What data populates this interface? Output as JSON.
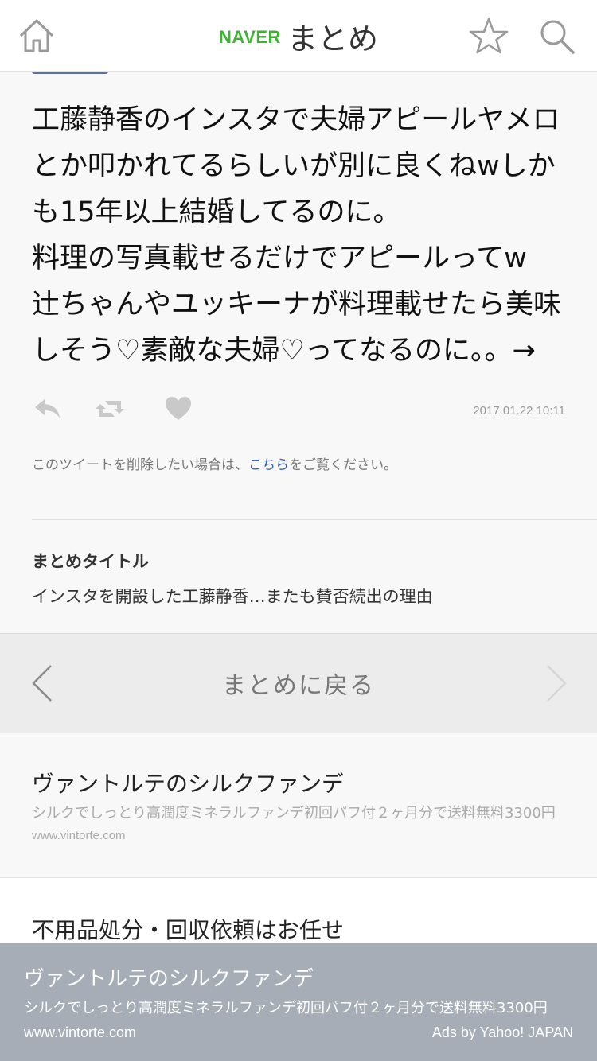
{
  "header": {
    "brand_naver": "NAVER",
    "brand_matome": "まとめ",
    "home_icon": "home-icon",
    "favorite_icon": "star-icon",
    "search_icon": "search-icon",
    "brand_color": "#3db233"
  },
  "tweet": {
    "lines": [
      "工藤静香のインスタで夫婦アピールヤメロ",
      "とか叩かれてるらしいが別に良くねwしか",
      "も15年以上結婚してるのに。",
      "料理の写真載せるだけでアピールってw",
      "辻ちゃんやユッキーナが料理載せたら美味",
      "しそう♡素敵な夫婦♡ってなるのに。。→"
    ],
    "timestamp": "2017.01.22 10:11",
    "actions": [
      "reply-icon",
      "retweet-icon",
      "like-icon"
    ],
    "delete_note_prefix": "このツイートを削除したい場合は、",
    "delete_note_link": "こちら",
    "delete_note_suffix": "をご覧ください。"
  },
  "matome": {
    "title_label": "まとめタイトル",
    "title_value": "インスタを開設した工藤静香…またも賛否続出の理由"
  },
  "back_bar": {
    "label": "まとめに戻る"
  },
  "ads": [
    {
      "title": "ヴァントルテのシルクファンデ",
      "description": "シルクでしっとり高潤度ミネラルファンデ初回パフ付２ヶ月分で送料無料3300円",
      "url": "www.vintorte.com"
    },
    {
      "title": "不用品処分・回収依頼はお任せ"
    }
  ],
  "overlay_ad": {
    "title": "ヴァントルテのシルクファンデ",
    "description": "シルクでしっとり高潤度ミネラルファンデ初回パフ付２ヶ月分で送料無料3300円",
    "url": "www.vintorte.com",
    "credit": "Ads by Yahoo! JAPAN"
  }
}
